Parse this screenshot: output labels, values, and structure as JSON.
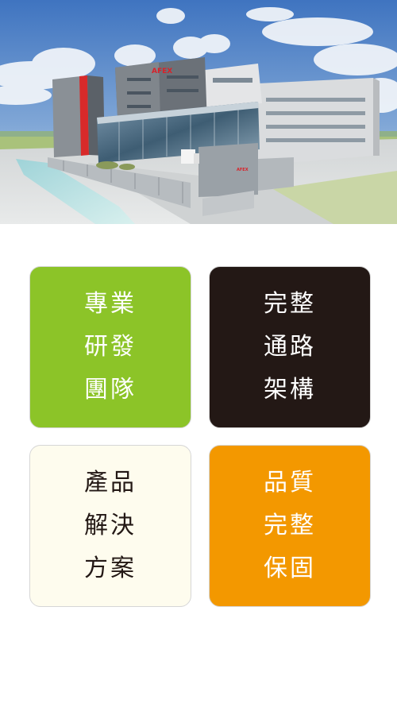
{
  "hero": {
    "sign_text": "AFEX"
  },
  "tiles": [
    {
      "lines": [
        "專業",
        "研發",
        "團隊"
      ],
      "bg": "#8cc428",
      "fg": "#ffffff"
    },
    {
      "lines": [
        "完整",
        "通路",
        "架構"
      ],
      "bg": "#231815",
      "fg": "#ffffff"
    },
    {
      "lines": [
        "產品",
        "解決",
        "方案"
      ],
      "bg": "#fefcee",
      "fg": "#231815"
    },
    {
      "lines": [
        "品質",
        "完整",
        "保固"
      ],
      "bg": "#f39800",
      "fg": "#ffffff"
    }
  ]
}
